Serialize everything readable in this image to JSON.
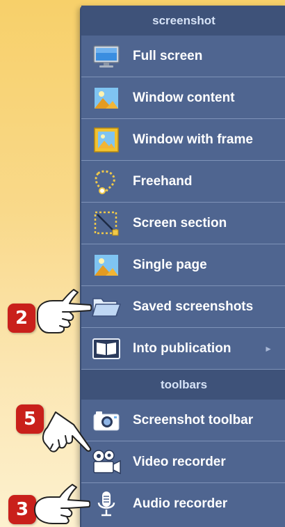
{
  "sections": [
    {
      "header": "screenshot",
      "items": [
        {
          "label": "Full screen",
          "icon": "monitor-icon"
        },
        {
          "label": "Window content",
          "icon": "image-icon"
        },
        {
          "label": "Window with frame",
          "icon": "framed-image-icon"
        },
        {
          "label": "Freehand",
          "icon": "lasso-icon"
        },
        {
          "label": "Screen section",
          "icon": "selection-icon"
        },
        {
          "label": "Single page",
          "icon": "image-icon"
        },
        {
          "label": "Saved screenshots",
          "icon": "folder-icon"
        },
        {
          "label": "Into publication",
          "icon": "book-icon",
          "submenu_arrow": "►"
        }
      ]
    },
    {
      "header": "toolbars",
      "items": [
        {
          "label": "Screenshot toolbar",
          "icon": "camera-icon"
        },
        {
          "label": "Video recorder",
          "icon": "video-camera-icon"
        },
        {
          "label": "Audio recorder",
          "icon": "microphone-icon"
        }
      ]
    }
  ],
  "callouts": [
    {
      "number": "2",
      "points_to": "Saved screenshots"
    },
    {
      "number": "5",
      "points_to": "Video recorder"
    },
    {
      "number": "3",
      "points_to": "Audio recorder"
    }
  ],
  "colors": {
    "menu_bg": "#4f6590",
    "header_bg": "#3e5279",
    "badge": "#c9201b",
    "background_top": "#f7d06a",
    "background_bottom": "#fdf1cf"
  }
}
